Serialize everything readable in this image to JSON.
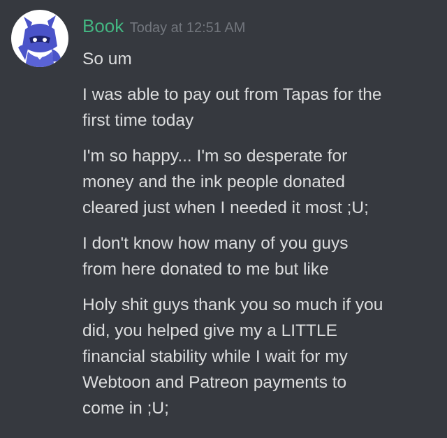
{
  "author": {
    "name": "Book",
    "timestamp": "Today at 12:51 AM",
    "name_color": "#43b581"
  },
  "theme": {
    "background": "#36393f",
    "text_color": "#dcddde",
    "timestamp_color": "#72767d",
    "avatar_background": "#ffffff",
    "avatar_accent": "#4a53c9"
  },
  "messages": [
    "So um",
    "I was able to pay out from Tapas for the\nfirst time today",
    "I'm so happy... I'm so desperate for\nmoney and the ink people donated\ncleared just when I needed it most ;U;",
    "I don't know how many of you guys\nfrom here donated to me but like",
    "Holy shit guys thank you so much if you\ndid, you helped give my a LITTLE\nfinancial stability while I wait for my\nWebtoon and Patreon payments to\ncome in ;U;"
  ]
}
